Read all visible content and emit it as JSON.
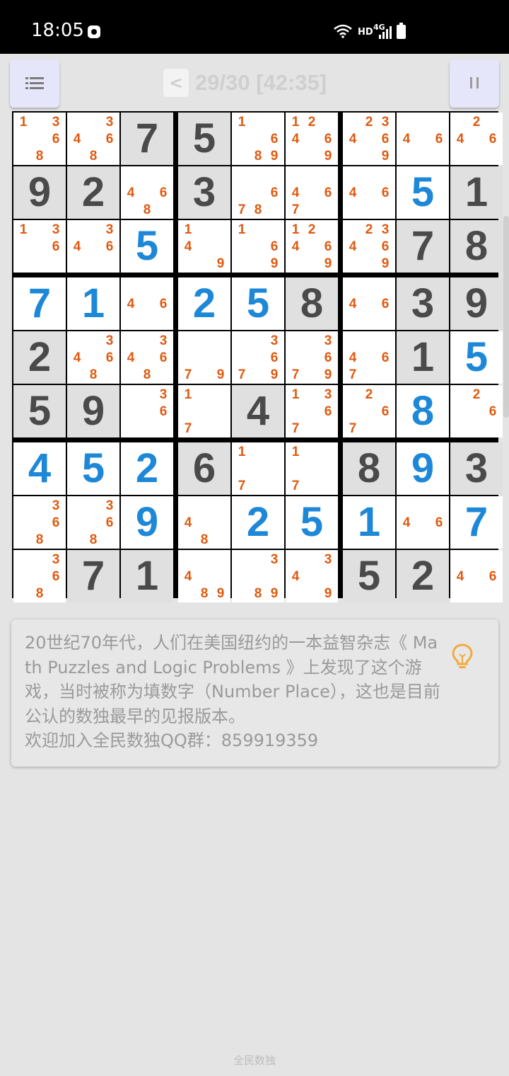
{
  "status_bar": {
    "time": "18:05",
    "network": "HD",
    "cell_type": "4G",
    "icons": [
      "game-controller-icon",
      "wifi-icon",
      "signal-icon",
      "battery-icon"
    ]
  },
  "header": {
    "menu_icon": "list-icon",
    "prev_label": "<",
    "level": "29/30 [42:35]",
    "pause_icon": "pause-icon"
  },
  "colors": {
    "given_digit": "#4a4a4a",
    "solved_digit": "#1e88d8",
    "candidate": "#e05a10",
    "given_cell_bg": "#e0e0e0",
    "level_text": "#cfcfcf",
    "button_bg": "#e6e6fa"
  },
  "board": {
    "rows": [
      [
        {
          "c": [
            1,
            3,
            6,
            8
          ]
        },
        {
          "c": [
            3,
            4,
            6,
            8
          ]
        },
        {
          "g": 7
        },
        {
          "g": 5
        },
        {
          "c": [
            1,
            6,
            8,
            9
          ]
        },
        {
          "c": [
            1,
            2,
            4,
            6,
            9
          ]
        },
        {
          "c": [
            2,
            3,
            4,
            6,
            9
          ]
        },
        {
          "c": [
            4,
            6
          ]
        },
        {
          "c": [
            2,
            4,
            6
          ]
        }
      ],
      [
        {
          "g": 9
        },
        {
          "g": 2
        },
        {
          "c": [
            4,
            6,
            8
          ]
        },
        {
          "g": 3
        },
        {
          "c": [
            6,
            7,
            8
          ]
        },
        {
          "c": [
            4,
            6,
            7
          ]
        },
        {
          "c": [
            4,
            6
          ]
        },
        {
          "s": 5
        },
        {
          "g": 1
        }
      ],
      [
        {
          "c": [
            1,
            3,
            6
          ]
        },
        {
          "c": [
            3,
            4,
            6
          ]
        },
        {
          "s": 5
        },
        {
          "c": [
            1,
            4,
            9
          ]
        },
        {
          "c": [
            1,
            6,
            9
          ]
        },
        {
          "c": [
            1,
            2,
            4,
            6,
            9
          ]
        },
        {
          "c": [
            2,
            3,
            4,
            6,
            9
          ]
        },
        {
          "g": 7
        },
        {
          "g": 8
        }
      ],
      [
        {
          "s": 7
        },
        {
          "s": 1
        },
        {
          "c": [
            4,
            6
          ]
        },
        {
          "s": 2
        },
        {
          "s": 5
        },
        {
          "g": 8
        },
        {
          "c": [
            4,
            6
          ]
        },
        {
          "g": 3
        },
        {
          "g": 9
        }
      ],
      [
        {
          "g": 2
        },
        {
          "c": [
            3,
            4,
            6,
            8
          ]
        },
        {
          "c": [
            3,
            4,
            6,
            8
          ]
        },
        {
          "c": [
            7,
            9
          ]
        },
        {
          "c": [
            3,
            6,
            7,
            9
          ]
        },
        {
          "c": [
            3,
            6,
            7,
            9
          ]
        },
        {
          "c": [
            4,
            6,
            7
          ]
        },
        {
          "g": 1
        },
        {
          "s": 5
        }
      ],
      [
        {
          "g": 5
        },
        {
          "g": 9
        },
        {
          "c": [
            3,
            6
          ]
        },
        {
          "c": [
            1,
            7
          ]
        },
        {
          "g": 4
        },
        {
          "c": [
            1,
            3,
            6,
            7
          ]
        },
        {
          "c": [
            2,
            6,
            7
          ]
        },
        {
          "s": 8
        },
        {
          "c": [
            2,
            6
          ]
        }
      ],
      [
        {
          "s": 4
        },
        {
          "s": 5
        },
        {
          "s": 2
        },
        {
          "g": 6
        },
        {
          "c": [
            1,
            7
          ]
        },
        {
          "c": [
            1,
            7
          ]
        },
        {
          "g": 8
        },
        {
          "s": 9
        },
        {
          "g": 3
        }
      ],
      [
        {
          "c": [
            3,
            6,
            8
          ]
        },
        {
          "c": [
            3,
            6,
            8
          ]
        },
        {
          "s": 9
        },
        {
          "c": [
            4,
            8
          ]
        },
        {
          "s": 2
        },
        {
          "s": 5
        },
        {
          "s": 1
        },
        {
          "c": [
            4,
            6
          ]
        },
        {
          "s": 7
        }
      ],
      [
        {
          "c": [
            3,
            6,
            8
          ]
        },
        {
          "g": 7
        },
        {
          "g": 1
        },
        {
          "c": [
            4,
            8,
            9
          ]
        },
        {
          "c": [
            3,
            8,
            9
          ]
        },
        {
          "c": [
            3,
            4,
            9
          ]
        },
        {
          "g": 5
        },
        {
          "g": 2
        },
        {
          "c": [
            4,
            6
          ]
        }
      ]
    ]
  },
  "tip": {
    "text": "20世纪70年代，人们在美国纽约的一本益智杂志《 Math Puzzles and Logic Problems 》上发现了这个游戏，当时被称为填数字（Number Place），这也是目前公认的数独最早的见报版本。\n欢迎加入全民数独QQ群：859919359",
    "icon": "lightbulb-icon"
  },
  "footer": {
    "app_name": "全民数独"
  }
}
